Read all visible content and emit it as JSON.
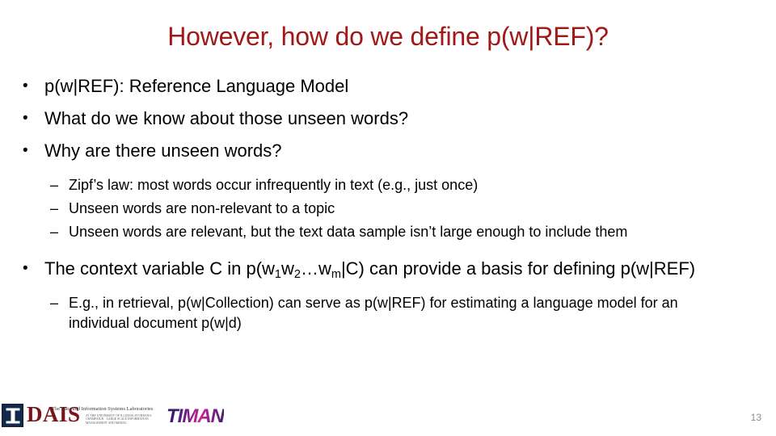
{
  "slide": {
    "title": "However, how do we define p(w|REF)?",
    "title_color": "#A01818",
    "background_color": "#FFFFFF",
    "page_number": "13"
  },
  "bullets": {
    "b1": "p(w|REF): Reference Language Model",
    "b2": "What do we know about those unseen words?",
    "b3": "Why are there unseen words?",
    "s1": "Zipf’s law: most words occur infrequently in text (e.g., just once)",
    "s2": "Unseen words are non-relevant to a topic",
    "s3": "Unseen words are relevant, but the text data sample isn’t large enough to include them",
    "b4_pre": "The context variable C in p(w",
    "b4_sub1": "1",
    "b4_mid1": "w",
    "b4_sub2": "2",
    "b4_mid2": "…w",
    "b4_sub3": "m",
    "b4_post": "|C) can provide a basis for defining p(w|REF)",
    "s4": "E.g., in retrieval, p(w|Collection) can serve as p(w|REF) for estimating a language model for an individual document p(w|d)",
    "mark_level1": "•",
    "mark_level2": "–"
  },
  "footer": {
    "dais_wordmark": "DAIS",
    "dais_tagline": "The Data and Information Systems Laboratories",
    "dais_tagline_small": "AT THE UNIVERSITY OF ILLINOIS AT URBANA-CHAMPAIGN  ·  LARGE SCALE INFORMATION MANAGEMENT AND MINING",
    "timan_wordmark": "TIMAN",
    "illinois_mark": "I",
    "illinois_navy": "#13294B",
    "dais_red": "#7B1418"
  }
}
